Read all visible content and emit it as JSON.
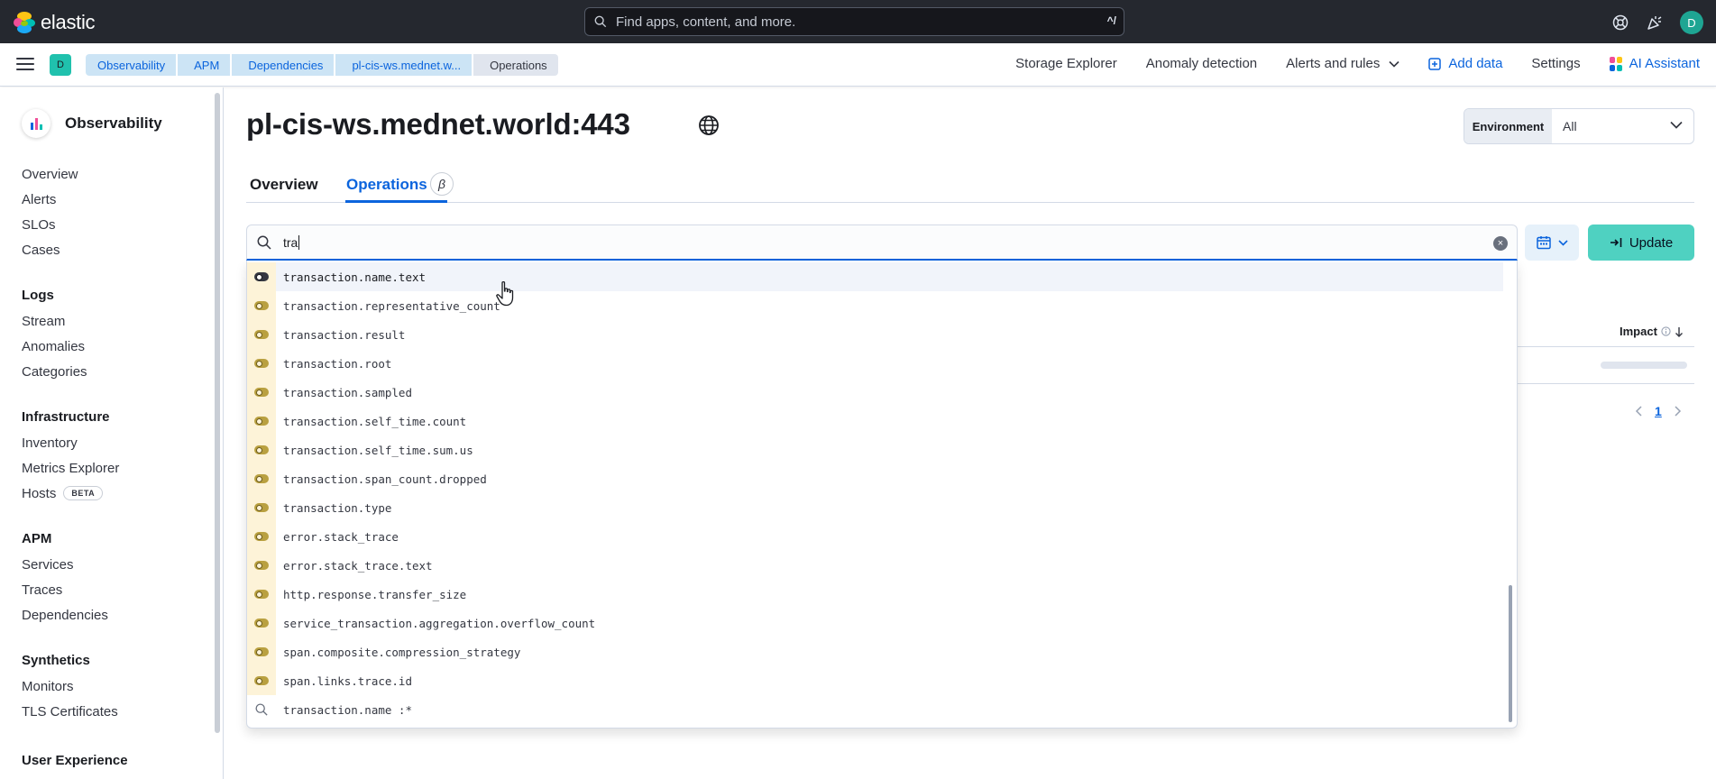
{
  "topbar": {
    "brand": "elastic",
    "search_placeholder": "Find apps, content, and more.",
    "search_shortcut": "^/",
    "avatar_initial": "D"
  },
  "subbar": {
    "space_initial": "D",
    "breadcrumbs": [
      "Observability",
      "APM",
      "Dependencies",
      "pl-cis-ws.mednet.w...",
      "Operations"
    ],
    "links": {
      "storage_explorer": "Storage Explorer",
      "anomaly_detection": "Anomaly detection",
      "alerts_rules": "Alerts and rules",
      "add_data": "Add data",
      "settings": "Settings",
      "ai_assistant": "AI Assistant"
    }
  },
  "sidebar": {
    "title": "Observability",
    "top_items": [
      "Overview",
      "Alerts",
      "SLOs",
      "Cases"
    ],
    "groups": [
      {
        "title": "Logs",
        "items": [
          "Stream",
          "Anomalies",
          "Categories"
        ]
      },
      {
        "title": "Infrastructure",
        "items": [
          "Inventory",
          "Metrics Explorer",
          "Hosts"
        ]
      },
      {
        "title": "APM",
        "items": [
          "Services",
          "Traces",
          "Dependencies"
        ]
      },
      {
        "title": "Synthetics",
        "items": [
          "Monitors",
          "TLS Certificates"
        ]
      },
      {
        "title": "User Experience",
        "items": []
      }
    ],
    "hosts_badge": "BETA"
  },
  "main": {
    "title": "pl-cis-ws.mednet.world:443",
    "environment_label": "Environment",
    "environment_value": "All",
    "tabs": [
      "Overview",
      "Operations"
    ],
    "beta_symbol": "β",
    "query": "tra",
    "update_label": "Update",
    "impact_label": "Impact",
    "page_number": "1"
  },
  "suggestions": [
    {
      "label": "transaction.name.text",
      "kind": "field",
      "highlighted": true
    },
    {
      "label": "transaction.representative_count",
      "kind": "field"
    },
    {
      "label": "transaction.result",
      "kind": "field"
    },
    {
      "label": "transaction.root",
      "kind": "field"
    },
    {
      "label": "transaction.sampled",
      "kind": "field"
    },
    {
      "label": "transaction.self_time.count",
      "kind": "field"
    },
    {
      "label": "transaction.self_time.sum.us",
      "kind": "field"
    },
    {
      "label": "transaction.span_count.dropped",
      "kind": "field"
    },
    {
      "label": "transaction.type",
      "kind": "field"
    },
    {
      "label": "error.stack_trace",
      "kind": "field"
    },
    {
      "label": "error.stack_trace.text",
      "kind": "field"
    },
    {
      "label": "http.response.transfer_size",
      "kind": "field"
    },
    {
      "label": "service_transaction.aggregation.overflow_count",
      "kind": "field"
    },
    {
      "label": "span.composite.compression_strategy",
      "kind": "field"
    },
    {
      "label": "span.links.trace.id",
      "kind": "field"
    },
    {
      "label": "transaction.name :*",
      "kind": "query"
    }
  ],
  "colors": {
    "topbar_bg": "#25282f",
    "accent_blue": "#0b64dd",
    "update_button": "#4fd1c1",
    "field_badge_bg": "#fdf3d8"
  }
}
